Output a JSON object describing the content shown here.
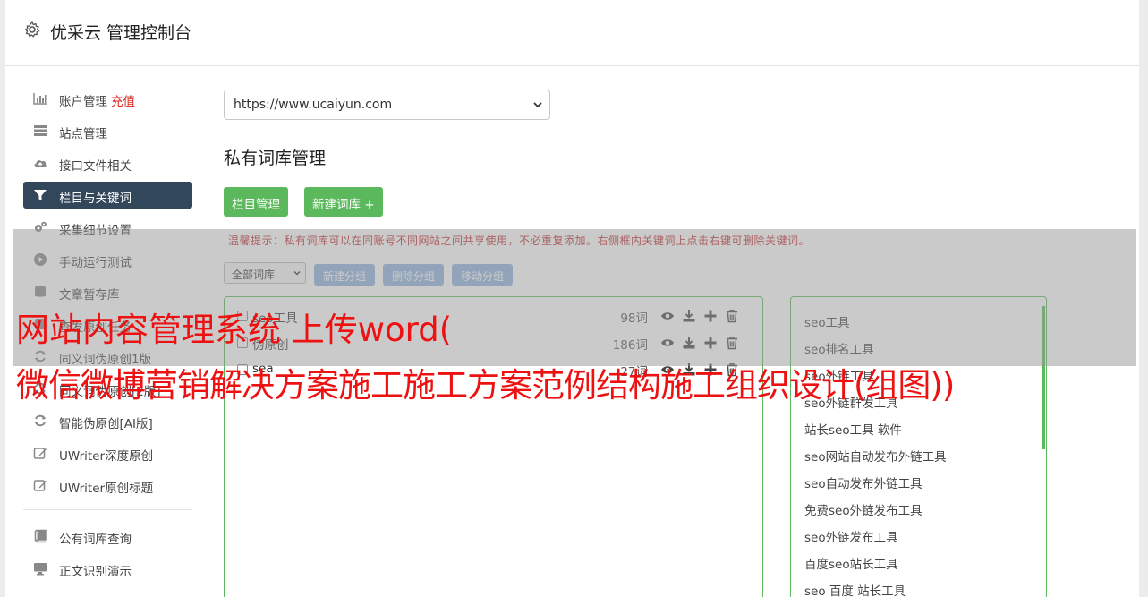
{
  "header": {
    "title": "优采云 管理控制台",
    "icon": "gear-icon"
  },
  "sidebar": {
    "items": [
      {
        "label": "账户管理",
        "extra": "充值",
        "icon": "bar-chart-icon"
      },
      {
        "label": "站点管理",
        "icon": "server-icon"
      },
      {
        "label": "接口文件相关",
        "icon": "cloud-upload-icon"
      },
      {
        "label": "栏目与关键词",
        "icon": "filter-icon",
        "active": true
      },
      {
        "label": "采集细节设置",
        "icon": "cogs-icon"
      },
      {
        "label": "手动运行测试",
        "icon": "play-circle-icon"
      },
      {
        "label": "文章暂存库",
        "icon": "database-icon"
      },
      {
        "label": "查发原创任务",
        "icon": "task-icon"
      },
      {
        "label": "同义词伪原创1版",
        "icon": "refresh-icon"
      },
      {
        "label": "同义词伪原创[2版]",
        "icon": "refresh-icon"
      },
      {
        "label": "智能伪原创[AI版]",
        "icon": "refresh-icon"
      },
      {
        "label": "UWriter深度原创",
        "icon": "edit-icon"
      },
      {
        "label": "UWriter原创标题",
        "icon": "edit-icon"
      }
    ],
    "items2": [
      {
        "label": "公有词库查询",
        "icon": "book-icon"
      },
      {
        "label": "正文识别演示",
        "icon": "monitor-icon"
      }
    ]
  },
  "main": {
    "site_select": "https://www.ucaiyun.com",
    "section_title": "私有词库管理",
    "btn_column": "栏目管理",
    "btn_new_library": "新建词库 +",
    "tip": "温馨提示：私有词库可以在同账号不同网站之间共享使用，不必重复添加。右侧框内关键词上点击右键可删除关键词。",
    "filter_select": "全部词库",
    "btn_new_group": "新建分组",
    "btn_delete_group": "删除分组",
    "btn_move_group": "移动分组",
    "libraries": [
      {
        "name": "seo工具",
        "count": "98词"
      },
      {
        "name": "伪原创",
        "count": "186词"
      },
      {
        "name": "sea",
        "count": "27词"
      }
    ],
    "keywords": [
      "seo工具",
      "seo排名工具",
      "seo外链工具",
      "seo外链群发工具",
      "站长seo工具 软件",
      "seo网站自动发布外链工具",
      "seo自动发布外链工具",
      "免费seo外链发布工具",
      "seo外链发布工具",
      "百度seo站长工具",
      "seo 百度 站长工具"
    ]
  },
  "overlay": {
    "line1": "网站内容管理系统 上传word(",
    "line2": "微信微博营销解决方案施工施工方案范例结构施工组织设计(组图))"
  },
  "colors": {
    "active_nav": "#33475b",
    "green": "#5cb85c",
    "blue_btn": "#8fb3dd",
    "overlay_text": "#ee1111",
    "tip": "#c02a2a"
  }
}
